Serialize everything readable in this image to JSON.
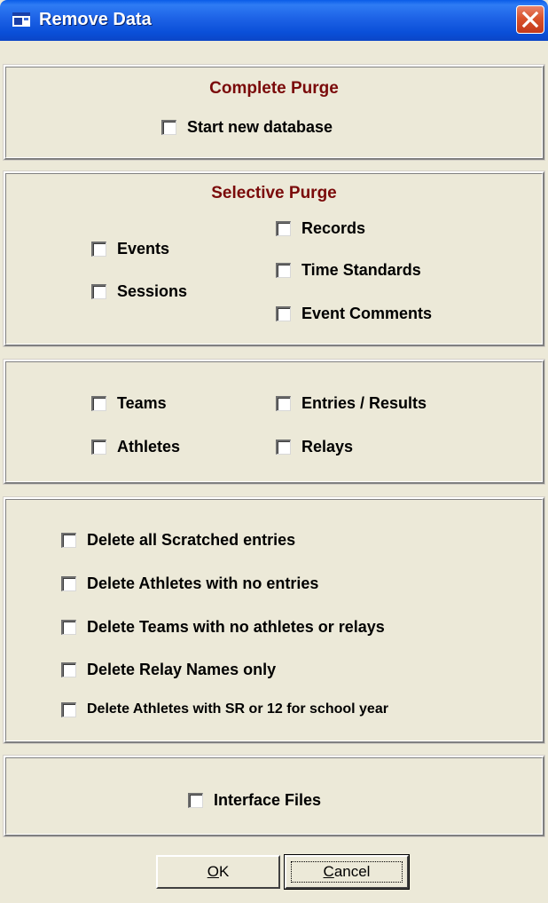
{
  "window": {
    "title": "Remove Data",
    "icon": "app-window-icon",
    "close_icon": "close-icon"
  },
  "complete_purge": {
    "title": "Complete Purge",
    "start_new_database": "Start new database"
  },
  "selective_purge": {
    "title": "Selective Purge",
    "events": "Events",
    "sessions": "Sessions",
    "records": "Records",
    "time_standards": "Time Standards",
    "event_comments": "Event Comments"
  },
  "people": {
    "teams": "Teams",
    "athletes": "Athletes",
    "entries_results": "Entries / Results",
    "relays": "Relays"
  },
  "deletes": {
    "scratched": "Delete all Scratched entries",
    "athletes_no_entries": "Delete Athletes with no entries",
    "teams_no_athletes": "Delete Teams with no athletes or relays",
    "relay_names": "Delete Relay Names only",
    "athletes_sr12": "Delete Athletes with SR or 12 for school year"
  },
  "interface": {
    "interface_files": "Interface Files"
  },
  "buttons": {
    "ok_mnemonic": "O",
    "ok_rest": "K",
    "cancel_mnemonic": "C",
    "cancel_rest": "ancel"
  },
  "colors": {
    "titlebar": "#0a4fd8",
    "group_title": "#7a0a0a",
    "dialog_bg": "#ece9d8",
    "close_button": "#d9532c"
  }
}
